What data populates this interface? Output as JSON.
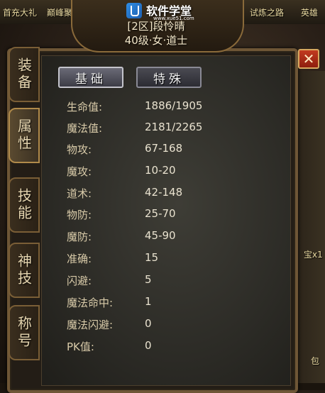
{
  "topbar": {
    "left_items": [
      "首充大礼",
      "巅峰聚盟"
    ],
    "right_items": [
      "试炼之路",
      "英雄"
    ]
  },
  "watermark": {
    "name": "软件学堂",
    "url": "www.xue51.com"
  },
  "character": {
    "server_name": "[2区]段怜晴",
    "info": "40级·女·道士"
  },
  "side_tabs": [
    {
      "label": "装备",
      "active": false
    },
    {
      "label": "属性",
      "active": true
    },
    {
      "label": "技能",
      "active": false
    },
    {
      "label": "神技",
      "active": false
    },
    {
      "label": "称号",
      "active": false
    }
  ],
  "top_tabs": [
    {
      "label": "基础",
      "active": true
    },
    {
      "label": "特殊",
      "active": false
    }
  ],
  "stats": [
    {
      "label": "生命值:",
      "value": "1886/1905"
    },
    {
      "label": "魔法值:",
      "value": "2181/2265"
    },
    {
      "label": "物攻:",
      "value": "67-168"
    },
    {
      "label": "魔攻:",
      "value": "10-20"
    },
    {
      "label": "道术:",
      "value": "42-148"
    },
    {
      "label": "物防:",
      "value": "25-70"
    },
    {
      "label": "魔防:",
      "value": "45-90"
    },
    {
      "label": "准确:",
      "value": "15"
    },
    {
      "label": "闪避:",
      "value": "5"
    },
    {
      "label": "魔法命中:",
      "value": "1"
    },
    {
      "label": "魔法闪避:",
      "value": "0"
    },
    {
      "label": "PK值:",
      "value": "0"
    }
  ],
  "scene_right": {
    "item_label": "宝x1",
    "bag_label": "包"
  }
}
